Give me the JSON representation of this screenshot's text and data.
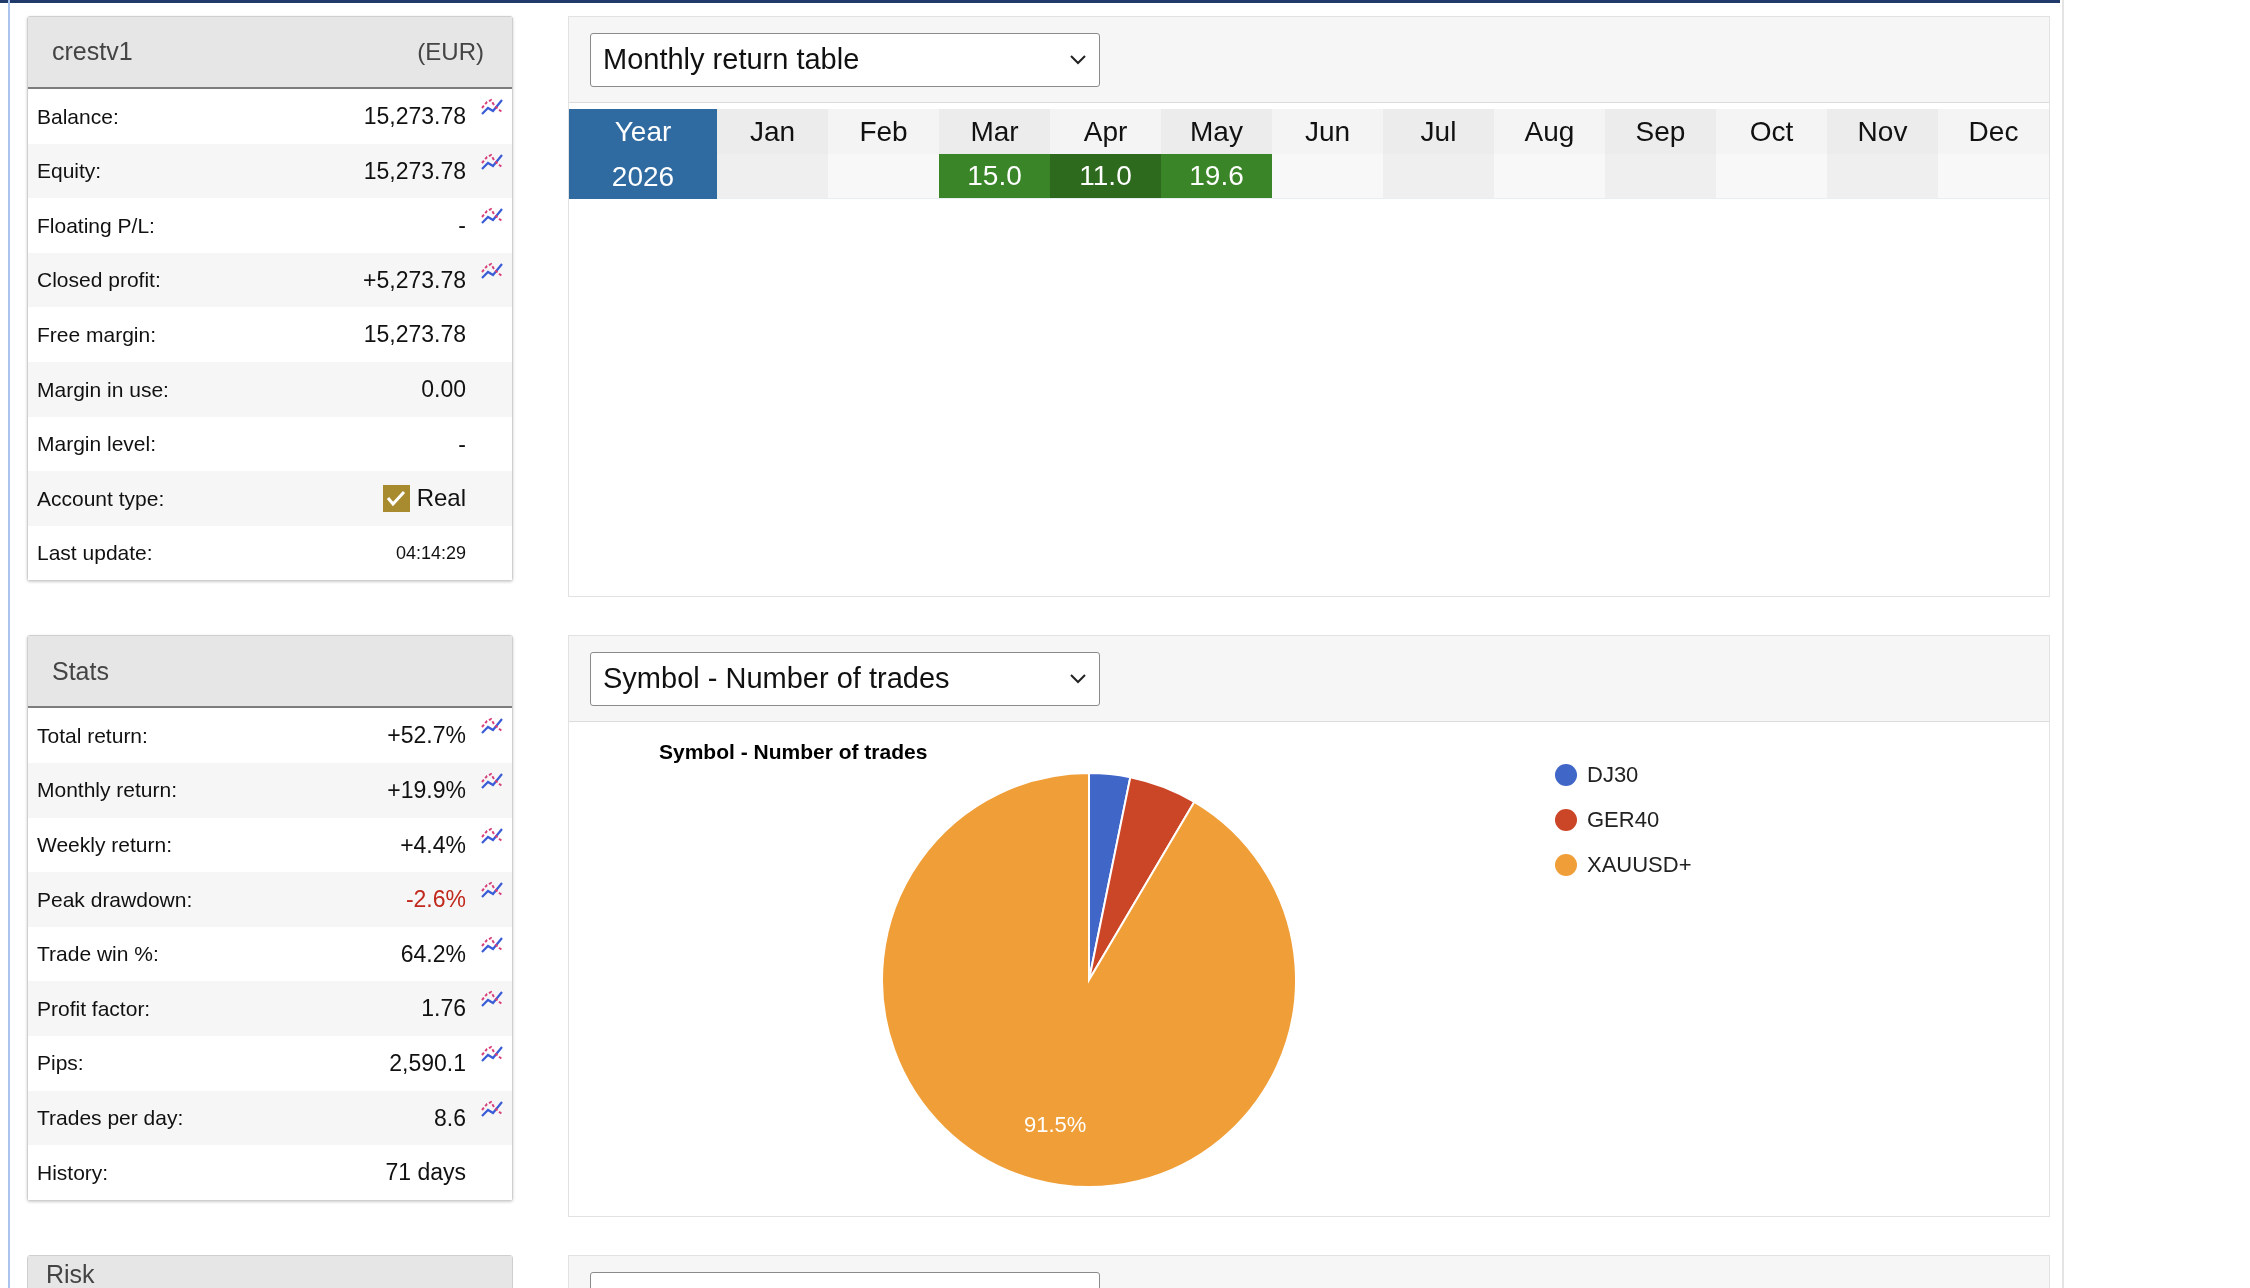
{
  "account": {
    "title": "crestv1",
    "currency": "(EUR)",
    "rows": [
      {
        "label": "Balance:",
        "kind": "text",
        "value": "15,273.78",
        "negative": false,
        "chart_link": true
      },
      {
        "label": "Equity:",
        "kind": "text",
        "value": "15,273.78",
        "negative": false,
        "chart_link": true
      },
      {
        "label": "Floating P/L:",
        "kind": "text",
        "value": "-",
        "negative": false,
        "chart_link": true
      },
      {
        "label": "Closed profit:",
        "kind": "text",
        "value": "+5,273.78",
        "negative": false,
        "chart_link": true
      },
      {
        "label": "Free margin:",
        "kind": "text",
        "value": "15,273.78",
        "negative": false,
        "chart_link": false
      },
      {
        "label": "Margin in use:",
        "kind": "text",
        "value": "0.00",
        "negative": false,
        "chart_link": false
      },
      {
        "label": "Margin level:",
        "kind": "text",
        "value": "-",
        "negative": false,
        "chart_link": false
      },
      {
        "label": "Account type:",
        "kind": "checkbox",
        "value": "Real",
        "checked": true,
        "chart_link": false
      },
      {
        "label": "Last update:",
        "kind": "time",
        "value": "04:14:29",
        "chart_link": false
      }
    ]
  },
  "stats": {
    "title": "Stats",
    "rows": [
      {
        "label": "Total return:",
        "kind": "text",
        "value": "+52.7%",
        "negative": false,
        "chart_link": true
      },
      {
        "label": "Monthly return:",
        "kind": "text",
        "value": "+19.9%",
        "negative": false,
        "chart_link": true
      },
      {
        "label": "Weekly return:",
        "kind": "text",
        "value": "+4.4%",
        "negative": false,
        "chart_link": true
      },
      {
        "label": "Peak drawdown:",
        "kind": "text",
        "value": "-2.6%",
        "negative": true,
        "chart_link": true
      },
      {
        "label": "Trade win %:",
        "kind": "text",
        "value": "64.2%",
        "negative": false,
        "chart_link": true
      },
      {
        "label": "Profit factor:",
        "kind": "text",
        "value": "1.76",
        "negative": false,
        "chart_link": true
      },
      {
        "label": "Pips:",
        "kind": "text",
        "value": "2,590.1",
        "negative": false,
        "chart_link": true
      },
      {
        "label": "Trades per day:",
        "kind": "text",
        "value": "8.6",
        "negative": false,
        "chart_link": true
      },
      {
        "label": "History:",
        "kind": "text",
        "value": "71 days",
        "negative": false,
        "chart_link": false
      }
    ]
  },
  "risk": {
    "title": "Risk"
  },
  "monthly_panel": {
    "select": "Monthly return table",
    "table": {
      "year_header": "Year",
      "months": [
        "Jan",
        "Feb",
        "Mar",
        "Apr",
        "May",
        "Jun",
        "Jul",
        "Aug",
        "Sep",
        "Oct",
        "Nov",
        "Dec"
      ],
      "rows": [
        {
          "year": "2026",
          "cells": [
            {
              "kind": "blank"
            },
            {
              "kind": "blank"
            },
            {
              "kind": "value",
              "text": "15.0",
              "color": "#3a8527"
            },
            {
              "kind": "value",
              "text": "11.0",
              "color": "#2e6a1e"
            },
            {
              "kind": "value",
              "text": "19.6",
              "color": "#3a8527"
            },
            {
              "kind": "blank"
            },
            {
              "kind": "blank"
            },
            {
              "kind": "blank"
            },
            {
              "kind": "blank"
            },
            {
              "kind": "blank"
            },
            {
              "kind": "blank"
            },
            {
              "kind": "blank"
            }
          ]
        }
      ]
    }
  },
  "symbol_panel": {
    "select": "Symbol - Number of trades",
    "chart_data": {
      "type": "pie",
      "title": "Symbol - Number of trades",
      "categories": [
        "DJ30",
        "GER40",
        "XAUUSD+"
      ],
      "values": [
        3.2,
        5.3,
        91.5
      ],
      "colors": [
        "#4066c8",
        "#cb4527",
        "#f09e38"
      ],
      "value_labels": [
        null,
        null,
        "91.5%"
      ],
      "legend": "right"
    }
  }
}
